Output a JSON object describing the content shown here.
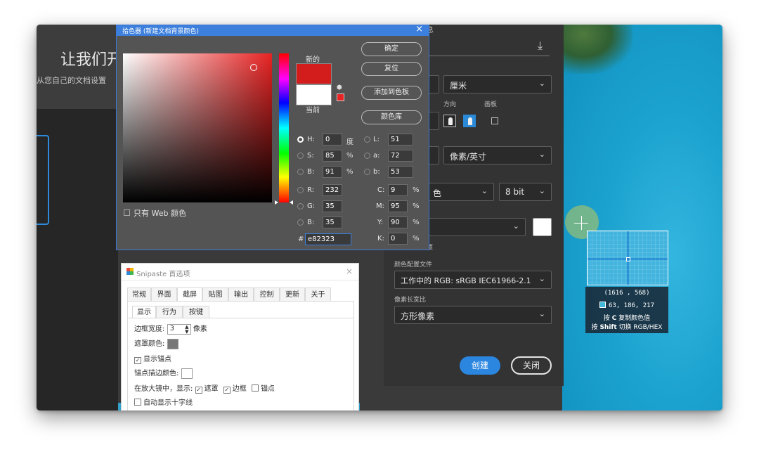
{
  "ps": {
    "heading": "让我们开",
    "subtitle": "从您自己的文档设置",
    "unit": "厘米",
    "orientation_label": "方向",
    "artboard_label": "画板",
    "resolution_unit": "像素/英寸",
    "color_mode_tail": "色",
    "bit_depth": "8 bit",
    "advanced_tail": "项",
    "color_profile_label": "颜色配置文件",
    "color_profile": "工作中的 RGB: sRGB IEC61966-2.1",
    "pixel_aspect_label": "像素长宽比",
    "pixel_aspect": "方形像素",
    "create": "创建",
    "close": "关闭",
    "title_tail": "息"
  },
  "picker": {
    "title": "拾色器 (新建文档背景颜色)",
    "new_label": "新的",
    "current_label": "当前",
    "ok": "确定",
    "reset": "复位",
    "add_swatch": "添加到色板",
    "color_library": "颜色库",
    "web_only": "只有 Web 颜色",
    "fields": {
      "H": "0",
      "S": "85",
      "B": "91",
      "R": "232",
      "G": "35",
      "B2": "35",
      "L": "51",
      "a": "72",
      "b": "53",
      "C": "9",
      "M": "95",
      "Y": "90",
      "K": "0"
    },
    "labels": {
      "H": "H:",
      "S": "S:",
      "B": "B:",
      "R": "R:",
      "G": "G:",
      "B2": "B:",
      "L": "L:",
      "a": "a:",
      "b": "b:",
      "C": "C:",
      "M": "M:",
      "Y": "Y:",
      "K": "K:",
      "hash": "#"
    },
    "units": {
      "deg": "度",
      "pct": "%"
    },
    "hex": "e82323",
    "new_color": "#d31d1d",
    "current_color": "#ffffff"
  },
  "snipaste": {
    "title": "Snipaste 首选项",
    "tabs": [
      "常规",
      "界面",
      "截屏",
      "贴图",
      "输出",
      "控制",
      "更新",
      "关于"
    ],
    "subtabs": [
      "显示",
      "行为",
      "按键"
    ],
    "border_width_label": "边框宽度:",
    "border_width": "3",
    "border_unit": "像素",
    "mask_color_label": "遮罩颜色:",
    "show_anchor": "显示锚点",
    "anchor_stroke_label": "锚点描边颜色:",
    "magnifier_row_label": "在放大镜中，显示:",
    "mask": "遮罩",
    "border": "边框",
    "anchor": "锚点",
    "auto_crosshair": "自动显示十字线"
  },
  "magnifier": {
    "coord": "(1616 , 568)",
    "rgb": "63, 186, 217",
    "hint_c_pre": "按",
    "hint_c_key": "C",
    "hint_c_post": "复制颜色值",
    "hint_shift_pre": "按",
    "hint_shift_key": "Shift",
    "hint_shift_post": "切换 RGB/HEX",
    "pixel_color": "#3fbad9"
  }
}
